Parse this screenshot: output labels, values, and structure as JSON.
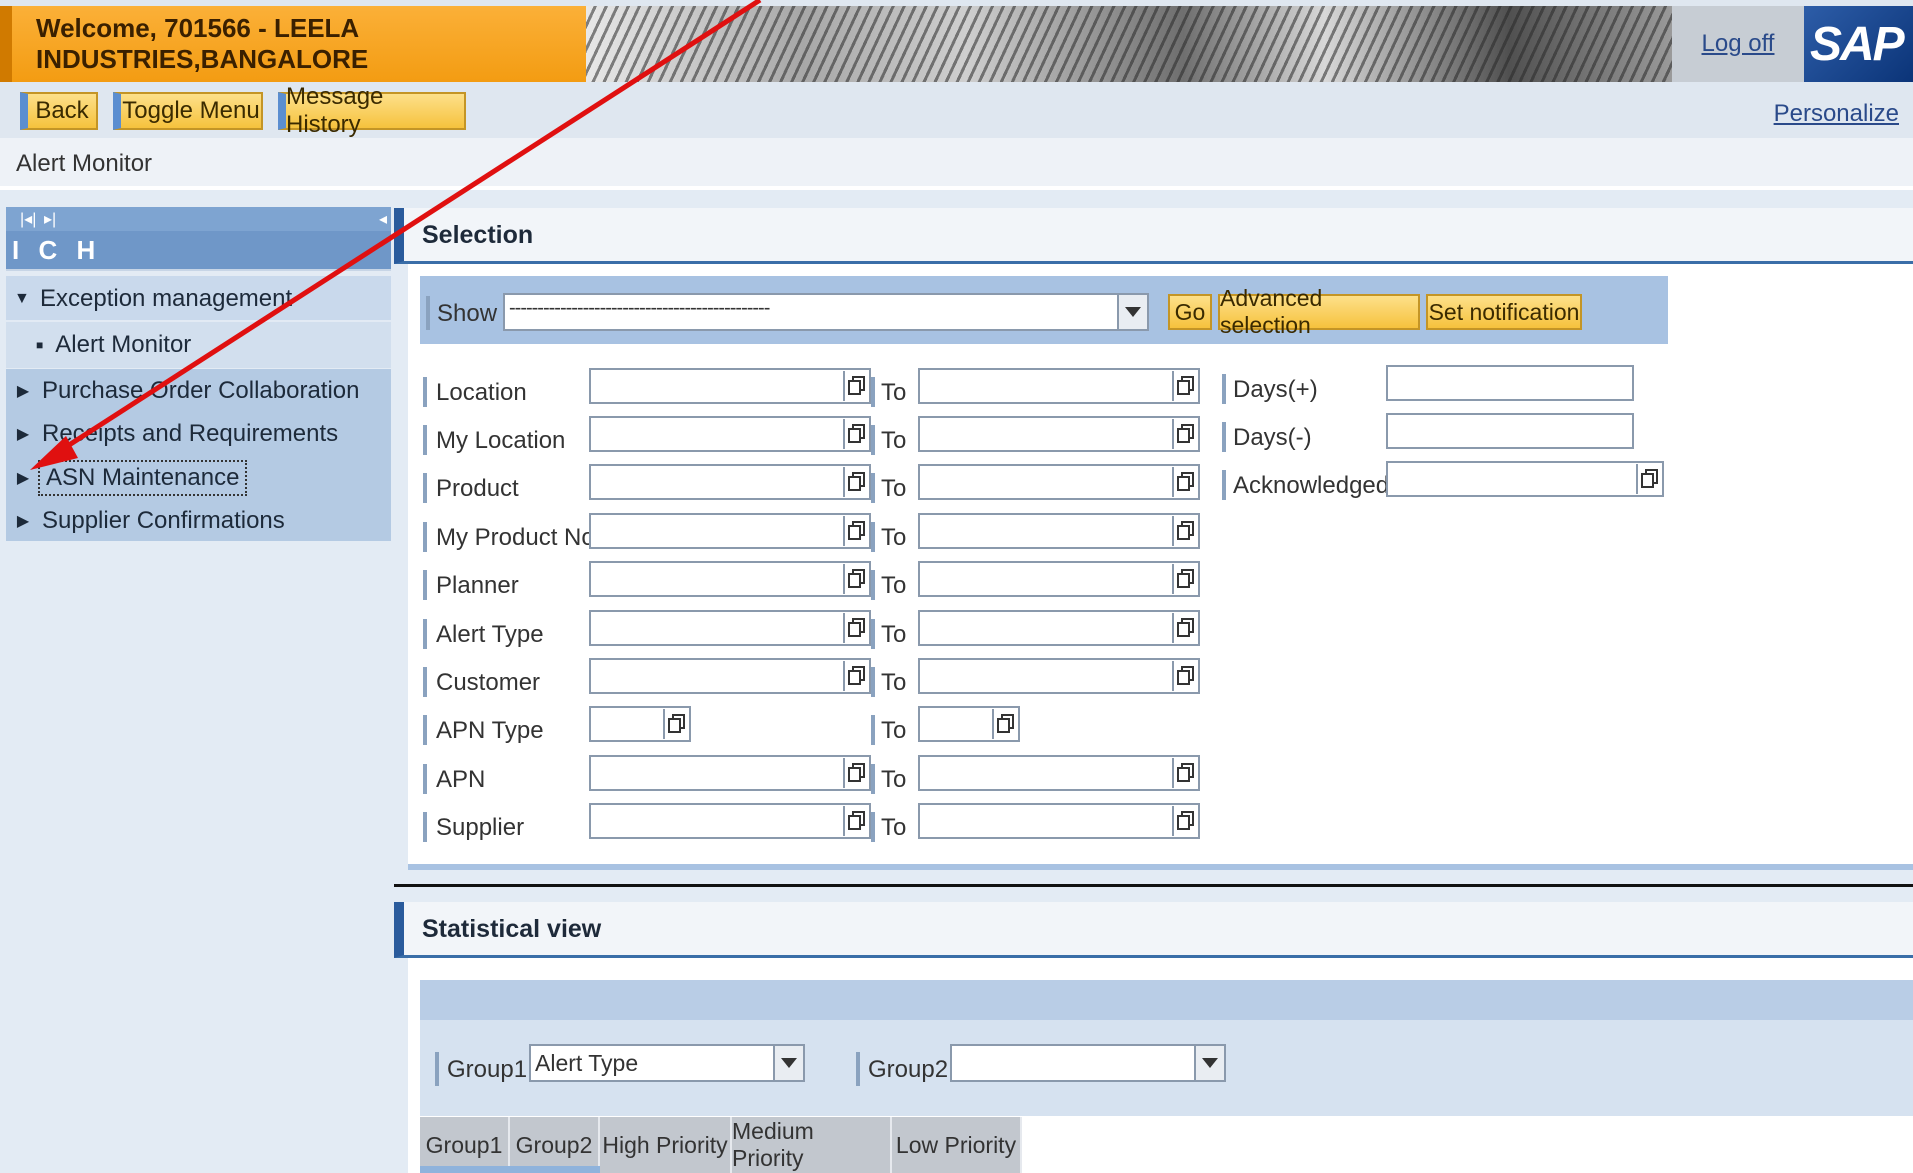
{
  "header": {
    "welcome": "Welcome, 701566 - LEELA INDUSTRIES,BANGALORE",
    "logoff": "Log off",
    "logo": "SAP"
  },
  "toolbar": {
    "back": "Back",
    "toggle_menu": "Toggle Menu",
    "message_history": "Message History",
    "personalize": "Personalize"
  },
  "page_title": "Alert Monitor",
  "nav": {
    "title": "I C H",
    "items": [
      {
        "label": "Exception management",
        "state": "expanded"
      },
      {
        "label": "Alert Monitor",
        "state": "leaf"
      },
      {
        "label": "Purchase Order Collaboration",
        "state": "collapsed"
      },
      {
        "label": "Receipts and Requirements",
        "state": "collapsed"
      },
      {
        "label": "ASN Maintenance",
        "state": "collapsed-focused"
      },
      {
        "label": "Supplier Confirmations",
        "state": "collapsed"
      }
    ]
  },
  "selection": {
    "title": "Selection",
    "show_label": "Show",
    "show_value": "----------------------------------------------",
    "go": "Go",
    "advanced": "Advanced selection",
    "set_notification": "Set notification",
    "to_label": "To",
    "fields": [
      "Location",
      "My Location",
      "Product",
      "My Product No.",
      "Planner",
      "Alert Type",
      "Customer",
      "APN Type",
      "APN",
      "Supplier"
    ],
    "right_fields": [
      "Days(+)",
      "Days(-)",
      "Acknowledged"
    ]
  },
  "statistical": {
    "title": "Statistical view",
    "group1_label": "Group1",
    "group1_value": "Alert Type",
    "group2_label": "Group2",
    "group2_value": "",
    "columns": [
      "Group1",
      "Group2",
      "High Priority",
      "Medium Priority",
      "Low Priority"
    ]
  },
  "colors": {
    "accent_orange": "#f39c12",
    "nav_blue": "#6f97c8",
    "annotation_red": "#e01010"
  }
}
